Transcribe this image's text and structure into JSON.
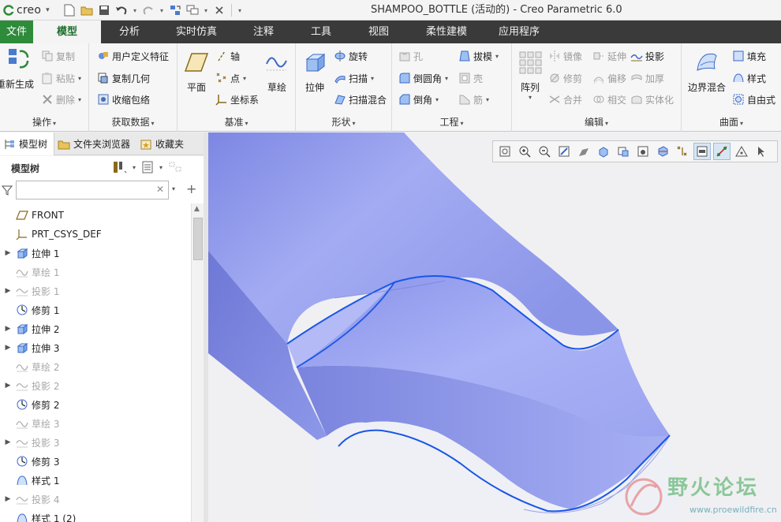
{
  "app": {
    "logo_text": "creo",
    "window_title": "SHAMPOO_BOTTLE (活动的) - Creo Parametric 6.0"
  },
  "tabs": [
    {
      "label": "文件"
    },
    {
      "label": "模型"
    },
    {
      "label": "分析"
    },
    {
      "label": "实时仿真"
    },
    {
      "label": "注释"
    },
    {
      "label": "工具"
    },
    {
      "label": "视图"
    },
    {
      "label": "柔性建模"
    },
    {
      "label": "应用程序"
    }
  ],
  "ribbon": {
    "operations": {
      "label": "操作",
      "regenerate": "重新生成",
      "copy": "复制",
      "paste": "粘贴",
      "delete": "删除"
    },
    "get_data": {
      "label": "获取数据",
      "udf": "用户定义特征",
      "copy_geom": "复制几何",
      "shrinkwrap": "收缩包络"
    },
    "datum": {
      "label": "基准",
      "plane": "平面",
      "axis": "轴",
      "point": "点",
      "csys": "坐标系",
      "sketch": "草绘"
    },
    "shapes": {
      "label": "形状",
      "extrude": "拉伸",
      "revolve": "旋转",
      "sweep": "扫描",
      "swept_blend": "扫描混合"
    },
    "engineering": {
      "label": "工程",
      "hole": "孔",
      "round": "倒圆角",
      "chamfer": "倒角",
      "draft": "拔模",
      "shell": "壳",
      "rib": "筋"
    },
    "editing": {
      "label": "编辑",
      "pattern": "阵列",
      "mirror": "镜像",
      "extend": "延伸",
      "project": "投影",
      "trim": "修剪",
      "offset": "偏移",
      "thicken": "加厚",
      "merge": "合并",
      "intersect": "相交",
      "solidify": "实体化"
    },
    "surfaces": {
      "label": "曲面",
      "boundary_blend": "边界混合",
      "fill": "填充",
      "style": "样式",
      "freestyle": "自由式"
    }
  },
  "panel": {
    "tabs": [
      {
        "label": "模型树"
      },
      {
        "label": "文件夹浏览器"
      },
      {
        "label": "收藏夹"
      }
    ],
    "tree_title": "模型树",
    "search_value": ""
  },
  "tree": [
    {
      "label": "FRONT",
      "icon": "datum-plane-icon",
      "expandable": false,
      "dim": false
    },
    {
      "label": "PRT_CSYS_DEF",
      "icon": "csys-icon",
      "expandable": false,
      "dim": false
    },
    {
      "label": "拉伸 1",
      "icon": "extrude-icon",
      "expandable": true,
      "dim": false
    },
    {
      "label": "草绘 1",
      "icon": "sketch-icon",
      "expandable": false,
      "dim": true
    },
    {
      "label": "投影 1",
      "icon": "project-icon",
      "expandable": true,
      "dim": true
    },
    {
      "label": "修剪 1",
      "icon": "trim-icon",
      "expandable": false,
      "dim": false
    },
    {
      "label": "拉伸 2",
      "icon": "extrude-icon",
      "expandable": true,
      "dim": false
    },
    {
      "label": "拉伸 3",
      "icon": "extrude-icon",
      "expandable": true,
      "dim": false
    },
    {
      "label": "草绘 2",
      "icon": "sketch-icon",
      "expandable": false,
      "dim": true
    },
    {
      "label": "投影 2",
      "icon": "project-icon",
      "expandable": true,
      "dim": true
    },
    {
      "label": "修剪 2",
      "icon": "trim-icon",
      "expandable": false,
      "dim": false
    },
    {
      "label": "草绘 3",
      "icon": "sketch-icon",
      "expandable": false,
      "dim": true
    },
    {
      "label": "投影 3",
      "icon": "project-icon",
      "expandable": true,
      "dim": true
    },
    {
      "label": "修剪 3",
      "icon": "trim-icon",
      "expandable": false,
      "dim": false
    },
    {
      "label": "样式 1",
      "icon": "style-icon",
      "expandable": false,
      "dim": false
    },
    {
      "label": "投影 4",
      "icon": "project-icon",
      "expandable": true,
      "dim": true
    },
    {
      "label": "样式 1 (2)",
      "icon": "style-icon",
      "expandable": false,
      "dim": false
    }
  ],
  "watermark": {
    "cn": "野火论坛",
    "url": "www.proewildfire.cn"
  },
  "colors": {
    "file_tab": "#2e8b3a",
    "active_tab_text": "#1b6e2a",
    "surface": "#a6b0f2",
    "edge_highlight": "#1a56e8"
  }
}
